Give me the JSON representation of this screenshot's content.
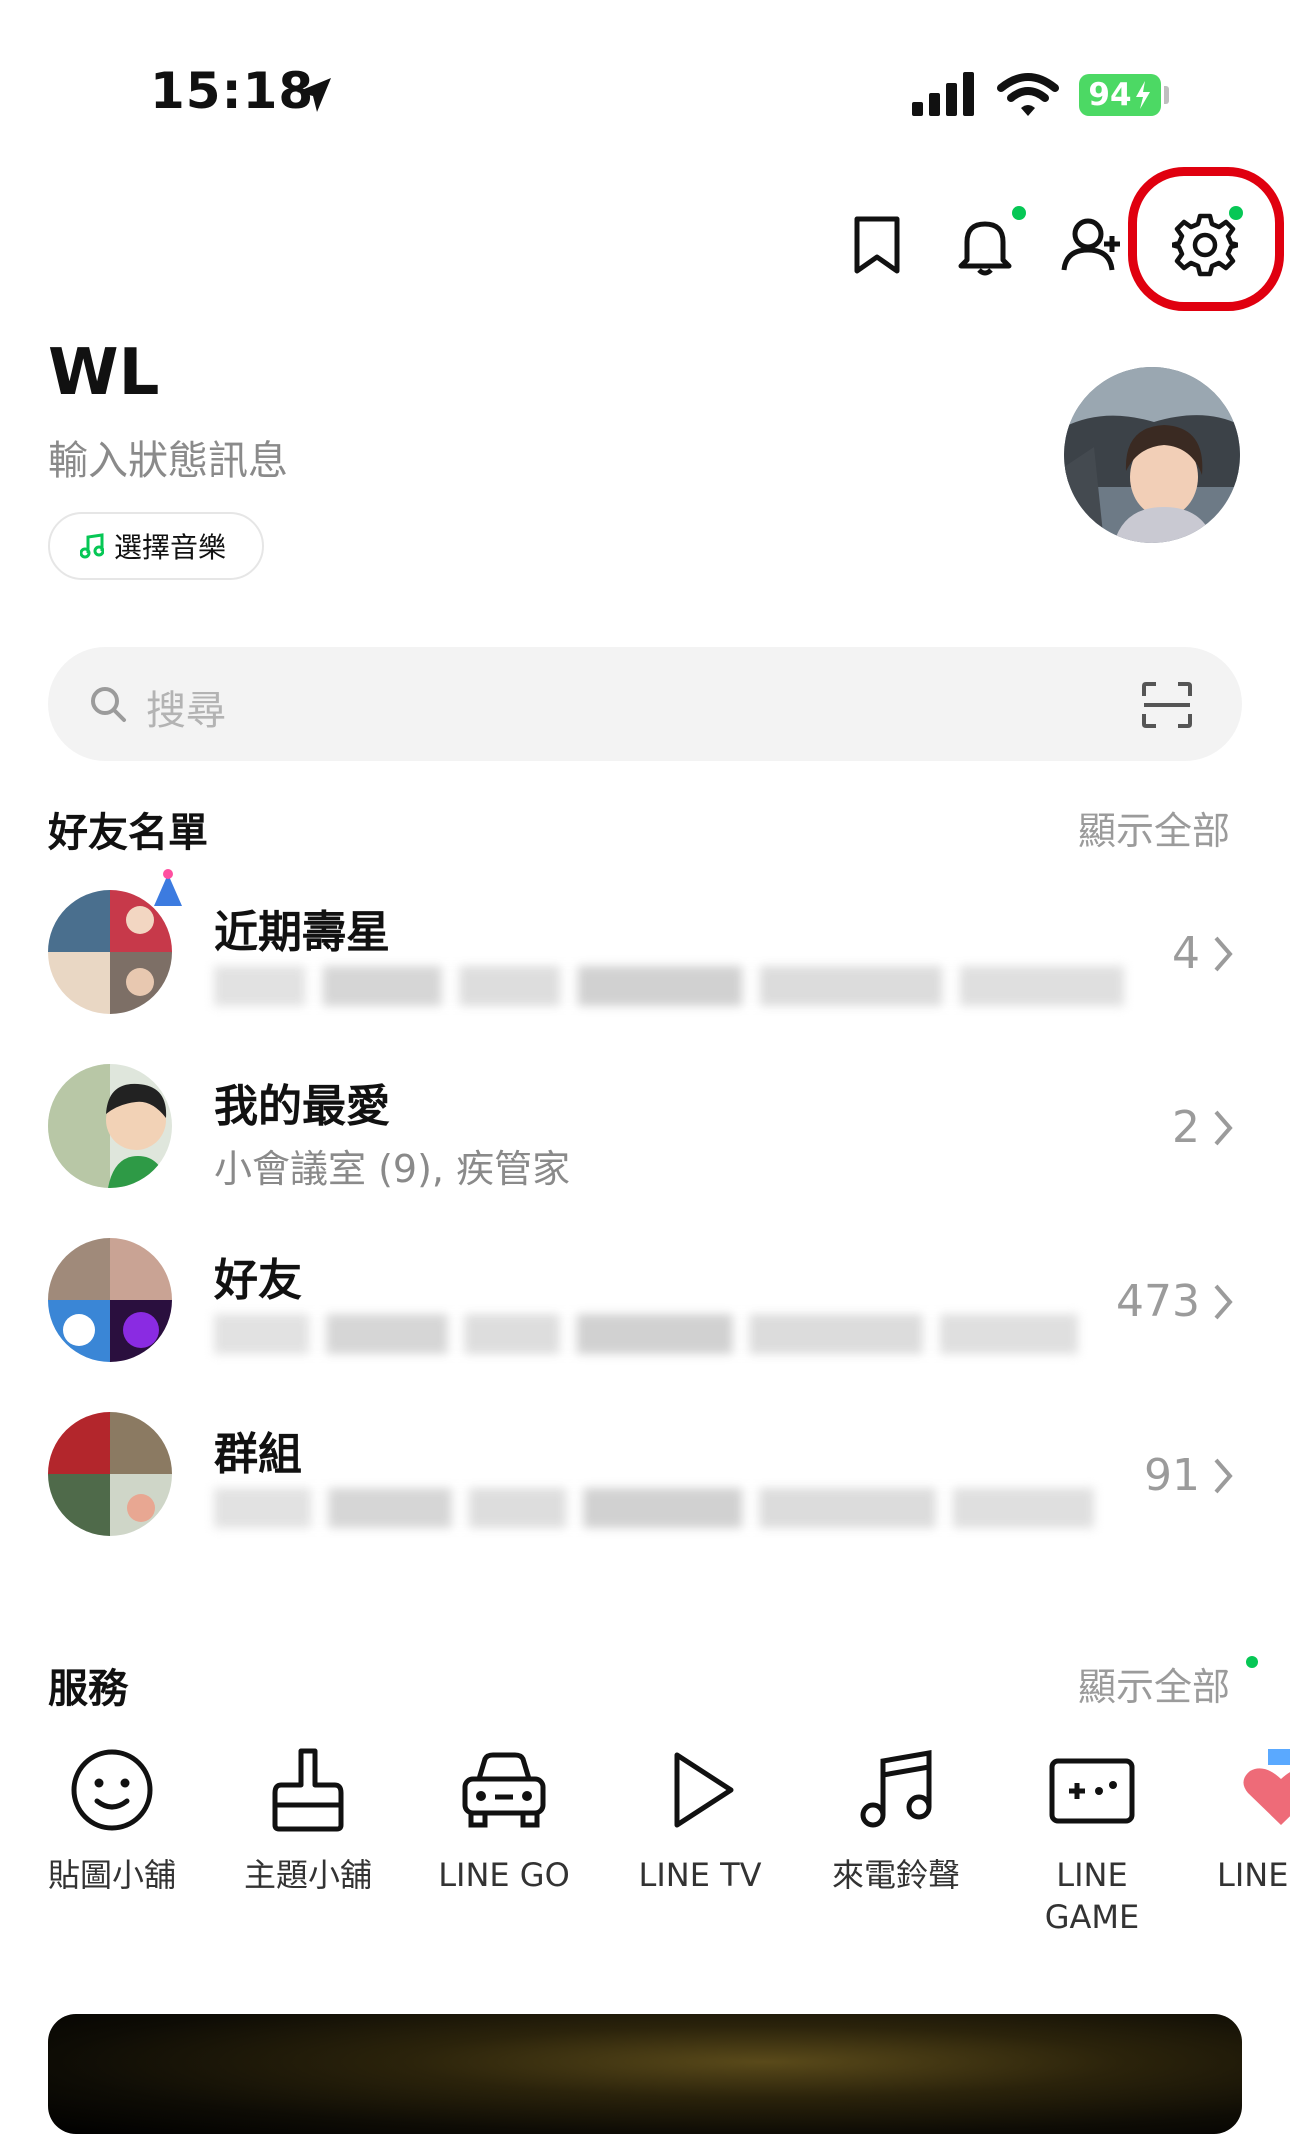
{
  "status_bar": {
    "time": "15:18",
    "battery": "94",
    "icons": [
      "location-arrow-icon",
      "signal-bars-icon",
      "wifi-icon",
      "battery-charging-icon"
    ]
  },
  "header": {
    "icons": [
      "bookmark-icon",
      "bell-icon",
      "add-friend-icon",
      "gear-icon"
    ],
    "highlight_color": "#e0000f",
    "badge_color": "#06c755"
  },
  "profile": {
    "name": "WL",
    "status_placeholder": "輸入狀態訊息",
    "music_button": "選擇音樂"
  },
  "search": {
    "placeholder": "搜尋"
  },
  "friends": {
    "title": "好友名單",
    "show_all": "顯示全部",
    "rows": [
      {
        "title": "近期壽星",
        "subtitle": "",
        "count": "4"
      },
      {
        "title": "我的最愛",
        "subtitle": "小會議室 (9), 疾管家",
        "count": "2"
      },
      {
        "title": "好友",
        "subtitle": "",
        "count": "473"
      },
      {
        "title": "群組",
        "subtitle": "",
        "count": "91"
      }
    ]
  },
  "services": {
    "title": "服務",
    "show_all": "顯示全部",
    "items": [
      {
        "label": "貼圖小舖",
        "icon": "smiley-icon"
      },
      {
        "label": "主題小舖",
        "icon": "paint-brush-icon"
      },
      {
        "label": "LINE GO",
        "icon": "car-icon"
      },
      {
        "label": "LINE TV",
        "icon": "play-icon"
      },
      {
        "label": "來電鈴聲",
        "icon": "music-note-icon"
      },
      {
        "label": "LINE GAME",
        "icon": "gamepad-icon"
      },
      {
        "label": "LINE",
        "icon": "heart-icon"
      }
    ]
  }
}
